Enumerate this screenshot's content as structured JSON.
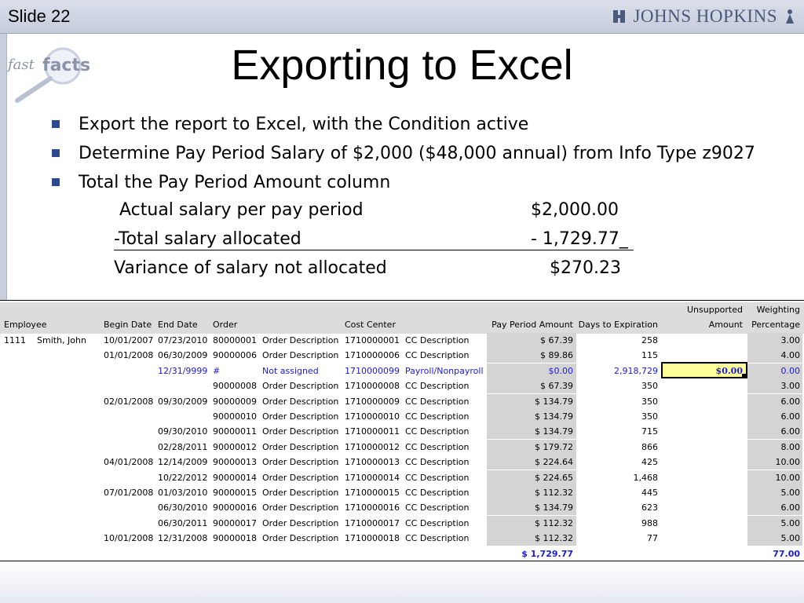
{
  "header": {
    "slide_label": "Slide 22",
    "logo_text": "JOHNS HOPKINS"
  },
  "logo": {
    "fast": "fast",
    "facts": "facts"
  },
  "title": "Exporting to Excel",
  "bullets": [
    "Export the report to Excel, with the Condition active",
    "Determine Pay Period Salary of $2,000 ($48,000 annual) from Info Type z9027",
    "Total the Pay Period Amount column"
  ],
  "calc": {
    "line1_label": "Actual salary per pay period",
    "line1_value": "$2,000.00",
    "line2_label": "-Total salary allocated",
    "line2_value": "- 1,729.77_",
    "line3_label": "Variance of salary not allocated",
    "line3_value": "$270.23"
  },
  "sheet": {
    "headers": {
      "employee": "Employee",
      "begin_date": "Begin Date",
      "end_date": "End Date",
      "order": "Order",
      "cost_center": "Cost Center",
      "pay_period_amount": "Pay Period Amount",
      "days_to_expiration": "Days to Expiration",
      "unsupported_1": "Unsupported",
      "unsupported_2": "Amount",
      "weighting_1": "Weighting",
      "weighting_2": "Percentage"
    },
    "rows": [
      {
        "emp_id": "1111",
        "emp_name": "Smith, John",
        "begin": "10/01/2007",
        "end": "07/23/2010",
        "order": "80000001",
        "order_desc": "Order Description",
        "cc": "1710000001",
        "cc_desc": "CC Description",
        "amount": "$ 67.39",
        "days": "258",
        "unsupported": "",
        "weight": "3.00"
      },
      {
        "emp_id": "",
        "emp_name": "",
        "begin": "01/01/2008",
        "end": "06/30/2009",
        "order": "90000006",
        "order_desc": "Order Description",
        "cc": "1710000006",
        "cc_desc": "CC Description",
        "amount": "$ 89.86",
        "days": "115",
        "unsupported": "",
        "weight": "4.00"
      },
      {
        "emp_id": "",
        "emp_name": "",
        "begin": "",
        "end": "12/31/9999",
        "order": "#",
        "order_desc": "Not assigned",
        "cc": "1710000099",
        "cc_desc": "Payroll/Nonpayroll",
        "amount": "$0.00",
        "days": "2,918,729",
        "unsupported": "$0.00",
        "weight": "0.00"
      },
      {
        "emp_id": "",
        "emp_name": "",
        "begin": "",
        "end": "",
        "order": "90000008",
        "order_desc": "Order Description",
        "cc": "1710000008",
        "cc_desc": "CC Description",
        "amount": "$ 67.39",
        "days": "350",
        "unsupported": "",
        "weight": "3.00"
      },
      {
        "emp_id": "",
        "emp_name": "",
        "begin": "02/01/2008",
        "end": "09/30/2009",
        "order": "90000009",
        "order_desc": "Order Description",
        "cc": "1710000009",
        "cc_desc": "CC Description",
        "amount": "$ 134.79",
        "days": "350",
        "unsupported": "",
        "weight": "6.00"
      },
      {
        "emp_id": "",
        "emp_name": "",
        "begin": "",
        "end": "",
        "order": "90000010",
        "order_desc": "Order Description",
        "cc": "1710000010",
        "cc_desc": "CC Description",
        "amount": "$ 134.79",
        "days": "350",
        "unsupported": "",
        "weight": "6.00"
      },
      {
        "emp_id": "",
        "emp_name": "",
        "begin": "",
        "end": "09/30/2010",
        "order": "90000011",
        "order_desc": "Order Description",
        "cc": "1710000011",
        "cc_desc": "CC Description",
        "amount": "$ 134.79",
        "days": "715",
        "unsupported": "",
        "weight": "6.00"
      },
      {
        "emp_id": "",
        "emp_name": "",
        "begin": "",
        "end": "02/28/2011",
        "order": "90000012",
        "order_desc": "Order Description",
        "cc": "1710000012",
        "cc_desc": "CC Description",
        "amount": "$ 179.72",
        "days": "866",
        "unsupported": "",
        "weight": "8.00"
      },
      {
        "emp_id": "",
        "emp_name": "",
        "begin": "04/01/2008",
        "end": "12/14/2009",
        "order": "90000013",
        "order_desc": "Order Description",
        "cc": "1710000013",
        "cc_desc": "CC Description",
        "amount": "$ 224.64",
        "days": "425",
        "unsupported": "",
        "weight": "10.00"
      },
      {
        "emp_id": "",
        "emp_name": "",
        "begin": "",
        "end": "10/22/2012",
        "order": "90000014",
        "order_desc": "Order Description",
        "cc": "1710000014",
        "cc_desc": "CC Description",
        "amount": "$ 224.65",
        "days": "1,468",
        "unsupported": "",
        "weight": "10.00"
      },
      {
        "emp_id": "",
        "emp_name": "",
        "begin": "07/01/2008",
        "end": "01/03/2010",
        "order": "90000015",
        "order_desc": "Order Description",
        "cc": "1710000015",
        "cc_desc": "CC Description",
        "amount": "$ 112.32",
        "days": "445",
        "unsupported": "",
        "weight": "5.00"
      },
      {
        "emp_id": "",
        "emp_name": "",
        "begin": "",
        "end": "06/30/2010",
        "order": "90000016",
        "order_desc": "Order Description",
        "cc": "1710000016",
        "cc_desc": "CC Description",
        "amount": "$ 134.79",
        "days": "623",
        "unsupported": "",
        "weight": "6.00"
      },
      {
        "emp_id": "",
        "emp_name": "",
        "begin": "",
        "end": "06/30/2011",
        "order": "90000017",
        "order_desc": "Order Description",
        "cc": "1710000017",
        "cc_desc": "CC Description",
        "amount": "$ 112.32",
        "days": "988",
        "unsupported": "",
        "weight": "5.00"
      },
      {
        "emp_id": "",
        "emp_name": "",
        "begin": "10/01/2008",
        "end": "12/31/2008",
        "order": "90000018",
        "order_desc": "Order Description",
        "cc": "1710000018",
        "cc_desc": "CC Description",
        "amount": "$ 112.32",
        "days": "77",
        "unsupported": "",
        "weight": "5.00"
      }
    ],
    "totals": {
      "amount": "$ 1,729.77",
      "weight": "77.00"
    },
    "colors": {
      "blue_text": "#1b1bd6",
      "highlight_cell": "#ffff99",
      "shaded_column": "#d4d4d4"
    }
  }
}
